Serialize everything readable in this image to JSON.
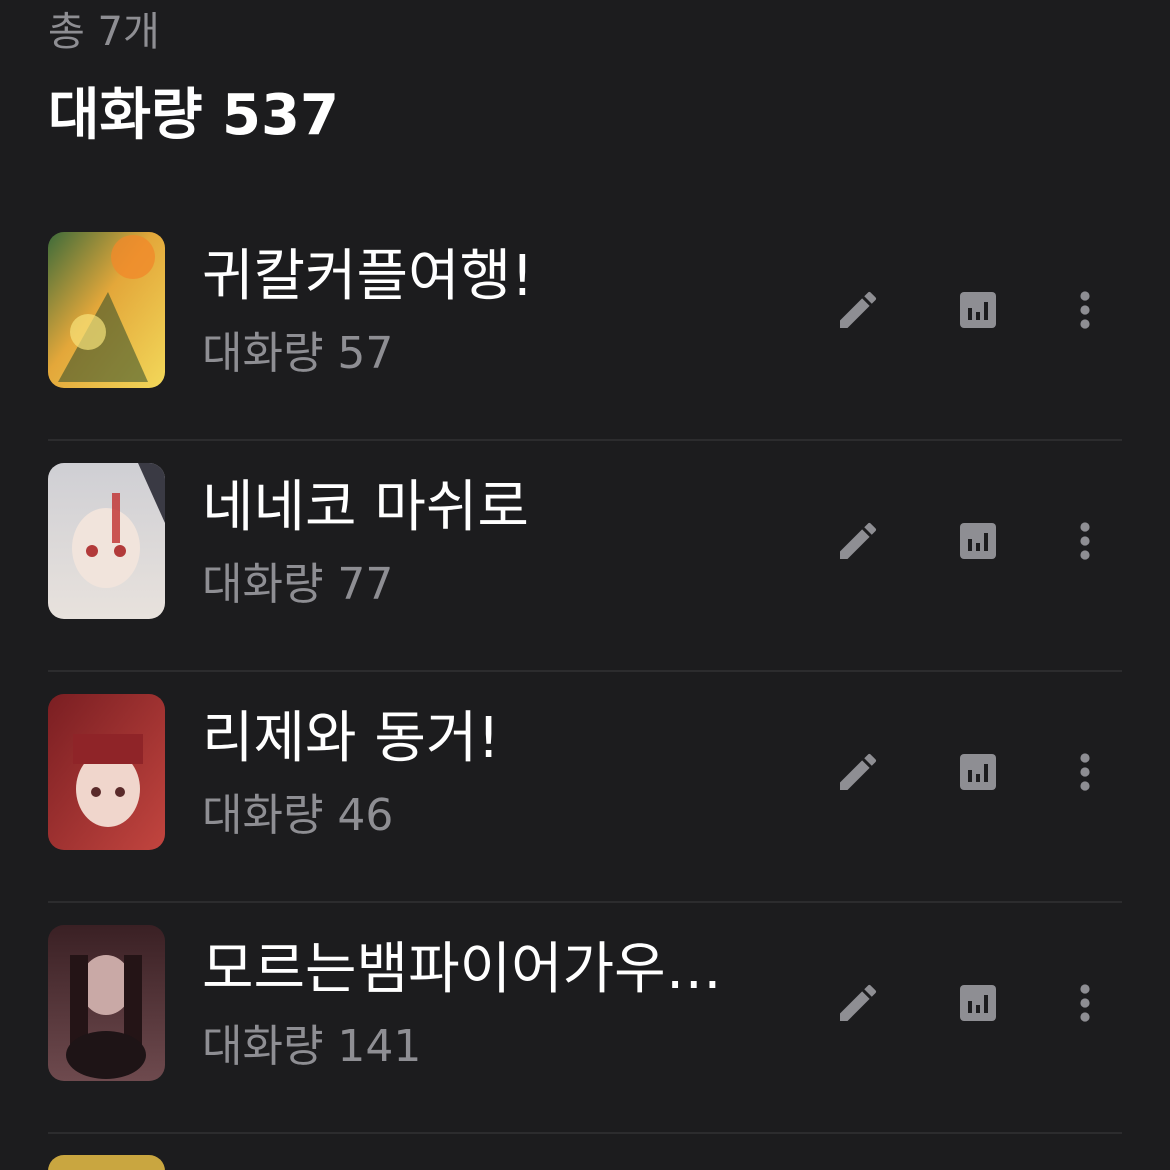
{
  "header": {
    "total_count": "총 7개",
    "total_volume": "대화량 537"
  },
  "items": [
    {
      "title": "귀칼커플여행!",
      "volume": "대화량 57"
    },
    {
      "title": "네네코 마쉬로",
      "volume": "대화량 77"
    },
    {
      "title": "리제와 동거!",
      "volume": "대화량 46"
    },
    {
      "title": "모르는뱀파이어가우리…",
      "volume": "대화량 141"
    }
  ],
  "icons": {
    "edit": "pencil-icon",
    "stats": "bar-chart-icon",
    "more": "more-vertical-icon"
  },
  "colors": {
    "background": "#1c1c1e",
    "secondary_text": "#8e8e93",
    "icon": "#8e8e93"
  }
}
